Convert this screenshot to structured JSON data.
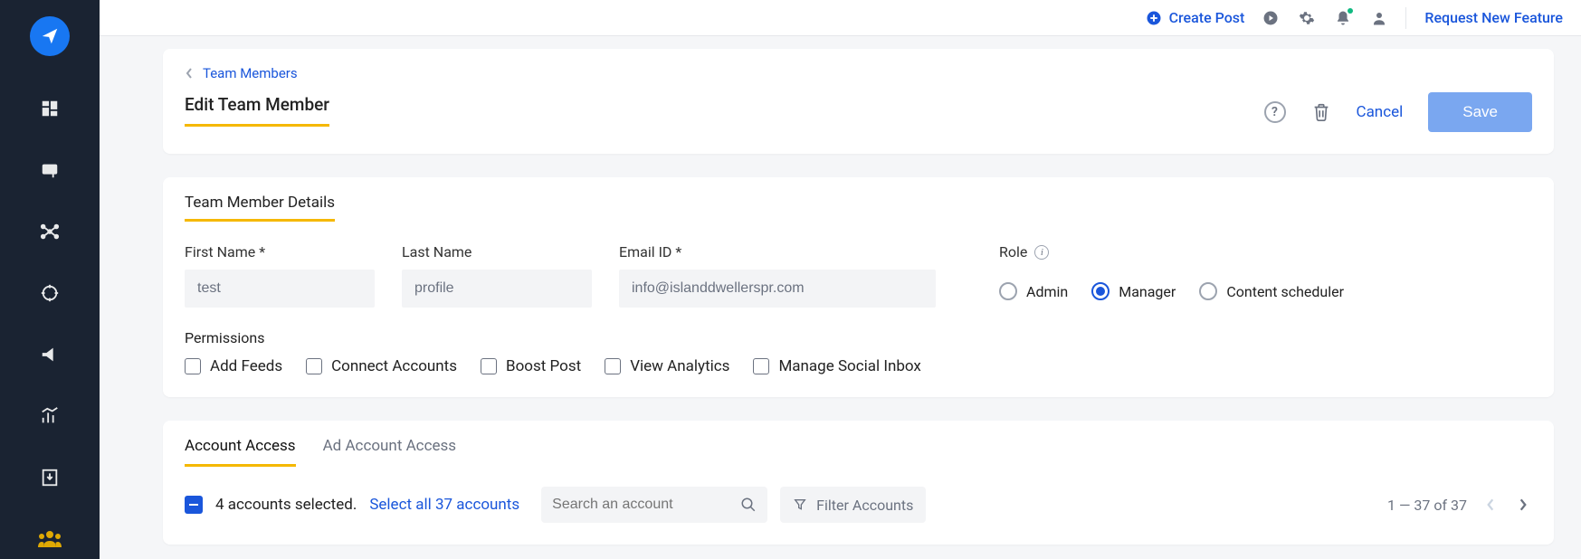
{
  "topbar": {
    "create_post": "Create Post",
    "request_feature": "Request New Feature"
  },
  "breadcrumb": {
    "label": "Team Members"
  },
  "header": {
    "title": "Edit Team Member",
    "cancel": "Cancel",
    "save": "Save"
  },
  "details": {
    "section_title": "Team Member Details",
    "first_name_label": "First Name *",
    "first_name_value": "test",
    "last_name_label": "Last Name",
    "last_name_value": "profile",
    "email_label": "Email ID *",
    "email_value": "info@islanddwellerspr.com",
    "role_label": "Role",
    "roles": {
      "admin": "Admin",
      "manager": "Manager",
      "content_scheduler": "Content scheduler",
      "selected": "manager"
    },
    "permissions_label": "Permissions",
    "permissions": {
      "add_feeds": "Add Feeds",
      "connect_accounts": "Connect Accounts",
      "boost_post": "Boost Post",
      "view_analytics": "View Analytics",
      "manage_social_inbox": "Manage Social Inbox"
    }
  },
  "access": {
    "tab_account": "Account Access",
    "tab_ad_account": "Ad Account Access",
    "active_tab": "account",
    "selected_text": "4 accounts selected.",
    "select_all_text": "Select all 37 accounts",
    "search_placeholder": "Search an account",
    "filter_label": "Filter Accounts",
    "pager_text": "1 — 37 of 37"
  }
}
